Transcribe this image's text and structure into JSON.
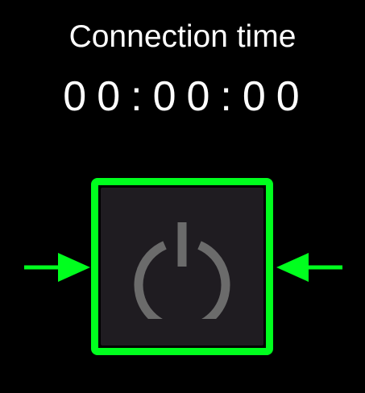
{
  "connection": {
    "title": "Connection time",
    "time": "00:00:00"
  },
  "power_button": {
    "icon": "power-icon",
    "highlight_color": "#00ff1e",
    "button_color": "#1f1c21",
    "icon_color": "#6b6b6b"
  },
  "indicators": {
    "left_arrow_icon": "arrow-right-icon",
    "right_arrow_icon": "arrow-left-icon"
  }
}
